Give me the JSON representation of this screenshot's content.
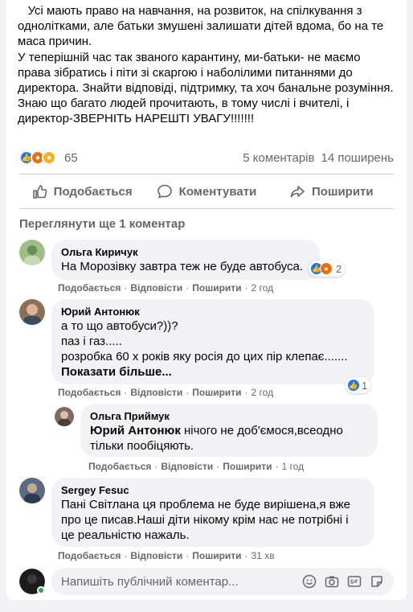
{
  "post": {
    "text": "   Усі мають право на навчання, на розвиток, на спілкування з однолітками, але батьки змушені залишати дітей вдома, бо на те маса причин.\nУ теперішній час так званого карантину, ми-батьки- не маємо права зібратись і піти зі скаргою і наболілими питаннями до директора. Знайти відповіді, підтримку, та хоч банальне розуміння.\nЗнаю що багато людей прочитають, в тому числі і вчителі, і директор-ЗВЕРНІТЬ НАРЕШТІ УВАГУ!!!!!!!",
    "reaction_count": "65",
    "comments_count": "5 коментарів",
    "shares_count": "14 поширень"
  },
  "actions": {
    "like": "Подобається",
    "comment": "Коментувати",
    "share": "Поширити"
  },
  "more_comments": "Переглянути ще 1 коментар",
  "meta_labels": {
    "like": "Подобається",
    "reply": "Відповісти",
    "share": "Поширити",
    "dot": "·"
  },
  "comments": [
    {
      "author": "Ольга Киричук",
      "text": "На Морозівку завтра теж не буде автобуса.",
      "time": "2 год",
      "reactions": "2"
    },
    {
      "author": "Юрий Антонюк",
      "text": "а то що автобуси?))?\nпаз і газ.....\nрозробка 60 х років яку росія до цих пір клепає.......",
      "show_more": "Показати більше...",
      "time": "2 год",
      "reactions": "1"
    },
    {
      "author": "Ольга Приймук",
      "mention": "Юрий Антонюк",
      "text": " нічого не доб'ємося,всеодно тільки пообіцяють.",
      "time": "1 год"
    },
    {
      "author": "Sergey Fesuc",
      "text": "Пані Світлана ця проблема не буде вирішена,я вже про це писав.Наші діти нікому крім нас не потрібні і це реальністю нажаль.",
      "time": "31 хв"
    }
  ],
  "composer": {
    "placeholder": "Напишіть публічний коментар..."
  },
  "colors": {
    "like_blue": "#1877f2",
    "angry_orange": "#e9710f",
    "sad_yellow": "#f7b125",
    "secondary_text": "#65676b",
    "online_green": "#31a24c"
  },
  "icons": [
    "like-reaction-icon",
    "angry-reaction-icon",
    "sad-reaction-icon",
    "thumbs-up-icon",
    "comment-icon",
    "share-icon",
    "emoji-icon",
    "camera-icon",
    "gif-icon",
    "sticker-icon"
  ]
}
